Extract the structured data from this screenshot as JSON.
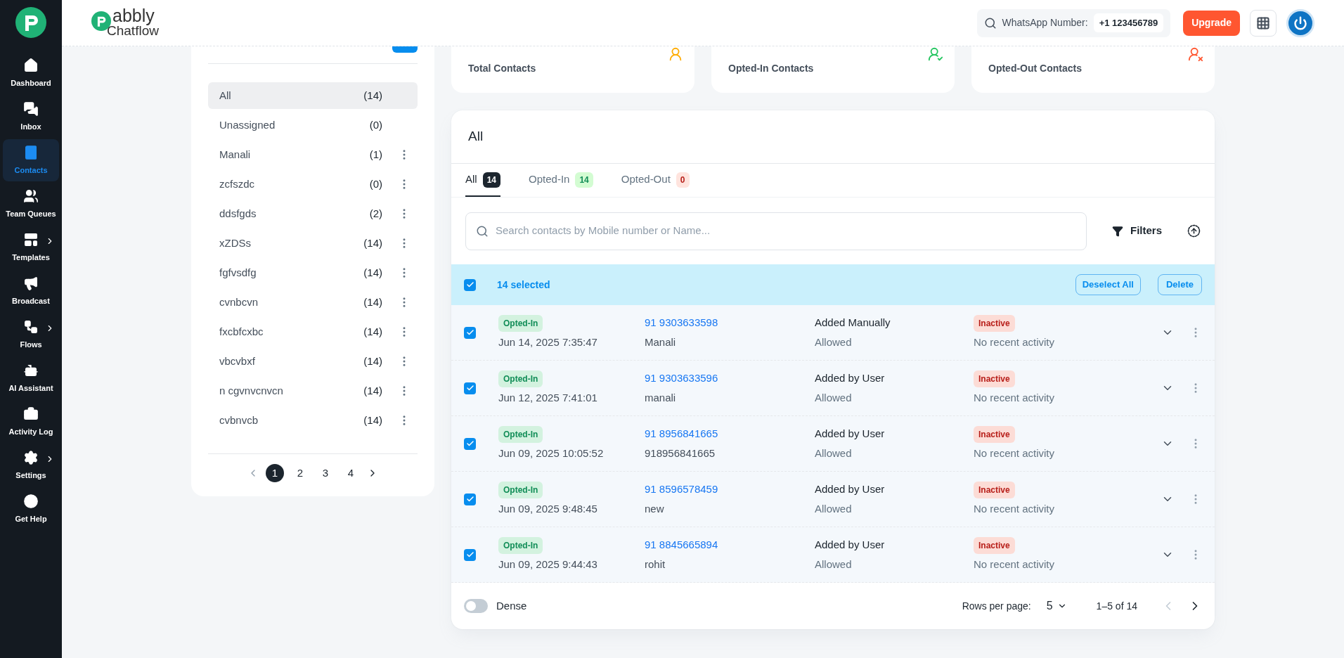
{
  "sidebar": {
    "items": [
      {
        "label": "Dashboard",
        "selected": false,
        "submenu": false
      },
      {
        "label": "Inbox",
        "selected": false,
        "submenu": false
      },
      {
        "label": "Contacts",
        "selected": true,
        "submenu": false
      },
      {
        "label": "Team Queues",
        "selected": false,
        "submenu": false
      },
      {
        "label": "Templates",
        "selected": false,
        "submenu": true
      },
      {
        "label": "Broadcast",
        "selected": false,
        "submenu": false
      },
      {
        "label": "Flows",
        "selected": false,
        "submenu": true
      },
      {
        "label": "AI Assistant",
        "selected": false,
        "submenu": false
      },
      {
        "label": "Activity Log",
        "selected": false,
        "submenu": false
      },
      {
        "label": "Settings",
        "selected": false,
        "submenu": true
      },
      {
        "label": "Get Help",
        "selected": false,
        "submenu": false
      }
    ]
  },
  "header": {
    "brand": "abbly",
    "product": "Chatflow",
    "whatsapp_label": "WhatsApp Number:",
    "whatsapp_number": "+1 123456789",
    "upgrade": "Upgrade"
  },
  "stats": [
    {
      "label": "Total Contacts",
      "color": "#ffab00"
    },
    {
      "label": "Opted-In Contacts",
      "color": "#22c55e"
    },
    {
      "label": "Opted-Out Contacts",
      "color": "#ff5630"
    }
  ],
  "groups": {
    "items": [
      {
        "name": "All",
        "count": "(14)",
        "selected": true,
        "menu": false
      },
      {
        "name": "Unassigned",
        "count": "(0)",
        "selected": false,
        "menu": false
      },
      {
        "name": "Manali",
        "count": "(1)",
        "selected": false,
        "menu": true
      },
      {
        "name": "zcfszdc",
        "count": "(0)",
        "selected": false,
        "menu": true
      },
      {
        "name": "ddsfgds",
        "count": "(2)",
        "selected": false,
        "menu": true
      },
      {
        "name": "xZDSs",
        "count": "(14)",
        "selected": false,
        "menu": true
      },
      {
        "name": "fgfvsdfg",
        "count": "(14)",
        "selected": false,
        "menu": true
      },
      {
        "name": "cvnbcvn",
        "count": "(14)",
        "selected": false,
        "menu": true
      },
      {
        "name": "fxcbfcxbc",
        "count": "(14)",
        "selected": false,
        "menu": true
      },
      {
        "name": "vbcvbxf",
        "count": "(14)",
        "selected": false,
        "menu": true
      },
      {
        "name": "n cgvnvcnvcn",
        "count": "(14)",
        "selected": false,
        "menu": true
      },
      {
        "name": "cvbnvcb",
        "count": "(14)",
        "selected": false,
        "menu": true
      }
    ],
    "pages": [
      {
        "label": "1",
        "selected": true
      },
      {
        "label": "2",
        "selected": false
      },
      {
        "label": "3",
        "selected": false
      },
      {
        "label": "4",
        "selected": false
      }
    ]
  },
  "contacts": {
    "title": "All",
    "tabs": [
      {
        "label": "All",
        "count": "14",
        "kind": "all",
        "selected": true
      },
      {
        "label": "Opted-In",
        "count": "14",
        "kind": "in",
        "selected": false
      },
      {
        "label": "Opted-Out",
        "count": "0",
        "kind": "out",
        "selected": false
      }
    ],
    "search_placeholder": "Search contacts by Mobile number or Name...",
    "filters": "Filters",
    "selection": {
      "checked": true,
      "text": "14 selected",
      "deselect": "Deselect All",
      "delete": "Delete"
    },
    "rows": [
      {
        "selected": true,
        "status": "Opted-In",
        "date": "Jun 14, 2025 7:35:47",
        "phone": "91 9303633598",
        "name": "Manali",
        "source": "Added Manually",
        "permission": "Allowed",
        "activity_status": "Inactive",
        "activity": "No recent activity"
      },
      {
        "selected": true,
        "status": "Opted-In",
        "date": "Jun 12, 2025 7:41:01",
        "phone": "91 9303633596",
        "name": "manali",
        "source": "Added by User",
        "permission": "Allowed",
        "activity_status": "Inactive",
        "activity": "No recent activity"
      },
      {
        "selected": true,
        "status": "Opted-In",
        "date": "Jun 09, 2025 10:05:52",
        "phone": "91 8956841665",
        "name": "918956841665",
        "source": "Added by User",
        "permission": "Allowed",
        "activity_status": "Inactive",
        "activity": "No recent activity"
      },
      {
        "selected": true,
        "status": "Opted-In",
        "date": "Jun 09, 2025 9:48:45",
        "phone": "91 8596578459",
        "name": "new",
        "source": "Added by User",
        "permission": "Allowed",
        "activity_status": "Inactive",
        "activity": "No recent activity"
      },
      {
        "selected": true,
        "status": "Opted-In",
        "date": "Jun 09, 2025 9:44:43",
        "phone": "91 8845665894",
        "name": "rohit",
        "source": "Added by User",
        "permission": "Allowed",
        "activity_status": "Inactive",
        "activity": "No recent activity"
      }
    ],
    "footer": {
      "dense_label": "Dense",
      "dense_on": false,
      "rows_label": "Rows per page:",
      "rows_value": "5",
      "range": "1–5 of 14",
      "prev_disabled": true,
      "next_disabled": false
    }
  }
}
